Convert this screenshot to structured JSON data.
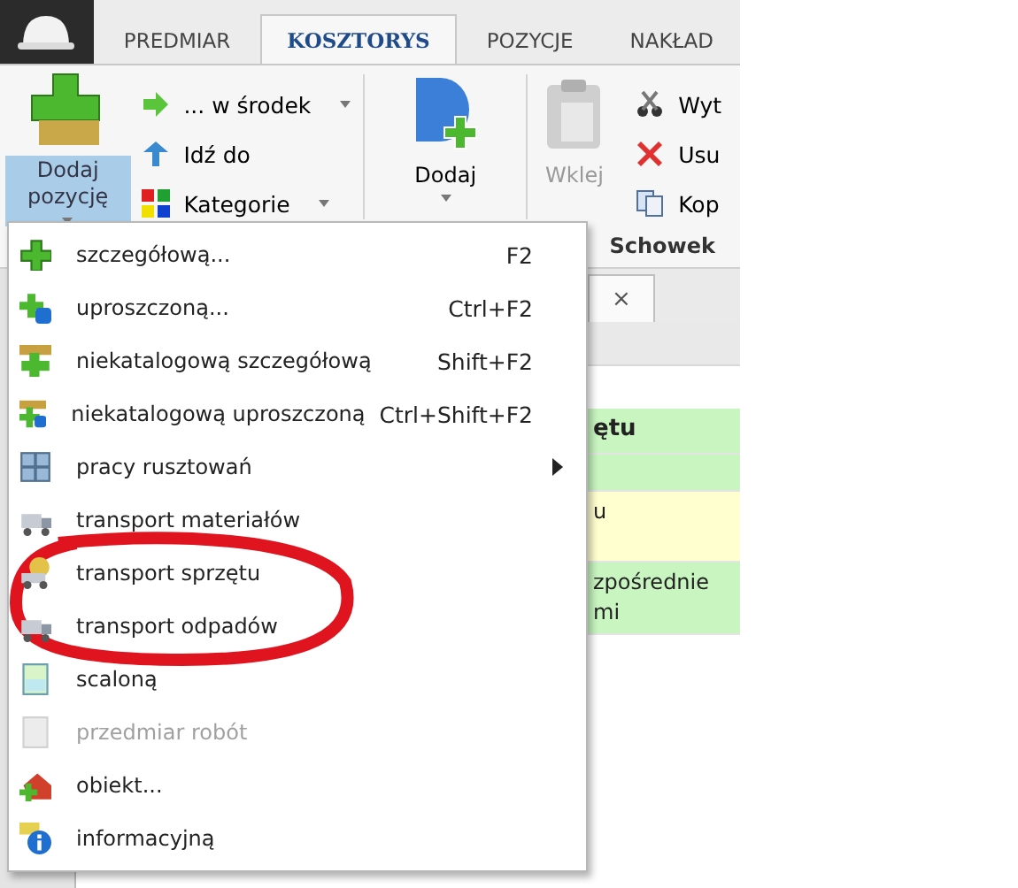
{
  "tabs": [
    {
      "label": "PREDMIAR",
      "selected": false
    },
    {
      "label": "KOSZTORYS",
      "selected": true
    },
    {
      "label": "POZYCJE",
      "selected": false
    },
    {
      "label": "NAKŁAD",
      "selected": false
    }
  ],
  "ribbon": {
    "add_position": {
      "label_line_1": "Dodaj",
      "label_line_2": "pozycję",
      "selected": true
    },
    "small_buttons": [
      {
        "label": "... w środek",
        "dropdown": true
      },
      {
        "label": "Idź do",
        "dropdown": false
      },
      {
        "label": "Kategorie",
        "dropdown": true
      }
    ],
    "add_button": {
      "label": "Dodaj"
    },
    "paste_button": {
      "label": "Wklej",
      "disabled": true
    },
    "clipboard_buttons": [
      {
        "label": "Wyt"
      },
      {
        "label": "Usu"
      },
      {
        "label": "Kop"
      }
    ],
    "group_label": "Schowek"
  },
  "document_tab": {
    "close": "×"
  },
  "table": {
    "header": {
      "text": "ętu",
      "color": "#c8f5c0"
    },
    "rows": [
      {
        "text": "",
        "color": "#c8f5c0"
      },
      {
        "text": "u",
        "color": "#ffffd0"
      },
      {
        "text": "zpośrednie\nmi",
        "color": "#c8f5c0"
      }
    ]
  },
  "menu": {
    "items": [
      {
        "label": "szczegółową...",
        "shortcut": "F2",
        "disabled": false,
        "submenu": false
      },
      {
        "label": "uproszczoną...",
        "shortcut": "Ctrl+F2",
        "disabled": false,
        "submenu": false
      },
      {
        "label": "niekatalogową szczegółową",
        "shortcut": "Shift+F2",
        "disabled": false,
        "submenu": false
      },
      {
        "label": "niekatalogową uproszczoną",
        "shortcut": "Ctrl+Shift+F2",
        "disabled": false,
        "submenu": false
      },
      {
        "label": "pracy rusztowań",
        "disabled": false,
        "submenu": true
      },
      {
        "label": "transport materiałów",
        "disabled": false,
        "submenu": false
      },
      {
        "label": "transport sprzętu",
        "disabled": false,
        "submenu": false
      },
      {
        "label": "transport odpadów",
        "disabled": false,
        "submenu": false
      },
      {
        "label": "scaloną",
        "disabled": false,
        "submenu": false
      },
      {
        "label": "przedmiar robót",
        "disabled": true,
        "submenu": false
      },
      {
        "label": "obiekt...",
        "disabled": false,
        "submenu": false
      },
      {
        "label": "informacyjną",
        "disabled": false,
        "submenu": false
      }
    ]
  },
  "annotation": {
    "kind": "ellipse",
    "color": "#e0141e"
  }
}
